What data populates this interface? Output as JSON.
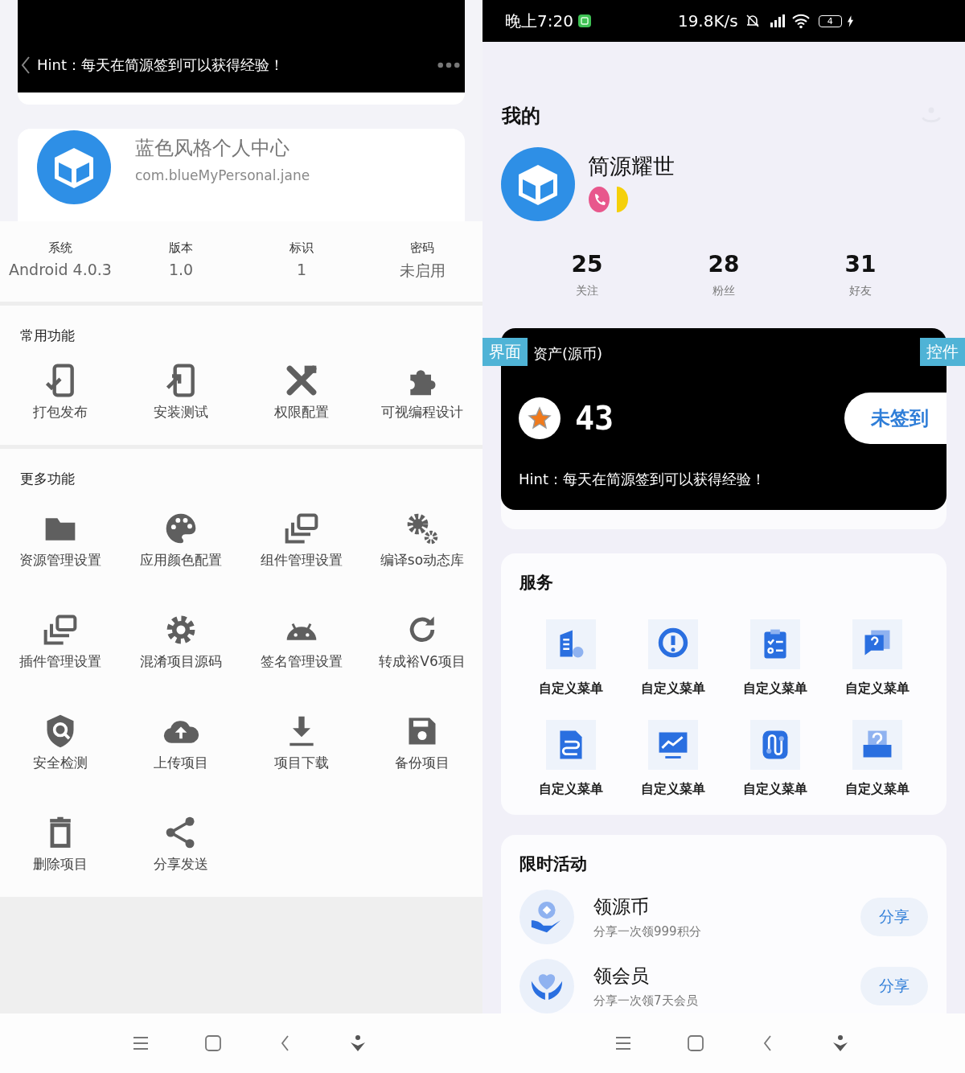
{
  "left_screen": {
    "asset_card": {
      "hint": "Hint：每天在简源签到可以获得经验！"
    },
    "app_card": {
      "title": "蓝色风格个人中心",
      "package": "com.blueMyPersonal.jane"
    },
    "info": [
      {
        "label": "系统",
        "value": "Android 4.0.3"
      },
      {
        "label": "版本",
        "value": "1.0"
      },
      {
        "label": "标识",
        "value": "1"
      },
      {
        "label": "密码",
        "value": "未启用"
      }
    ],
    "sections": [
      {
        "title": "常用功能",
        "items": [
          "打包发布",
          "安装测试",
          "权限配置",
          "可视编程设计"
        ]
      },
      {
        "title": "更多功能",
        "items": [
          "资源管理设置",
          "应用颜色配置",
          "组件管理设置",
          "编译so动态库",
          "插件管理设置",
          "混淆项目源码",
          "签名管理设置",
          "转成裕V6项目",
          "安全检测",
          "上传项目",
          "项目下载",
          "备份项目",
          "删除项目",
          "分享发送"
        ]
      }
    ]
  },
  "right_screen": {
    "status_bar": {
      "time": "晚上7:20",
      "speed": "19.8K/s",
      "battery": "4"
    },
    "title": "我的",
    "profile": {
      "name": "简源耀世"
    },
    "stats": [
      {
        "value": "25",
        "label": "关注"
      },
      {
        "value": "28",
        "label": "粉丝"
      },
      {
        "value": "31",
        "label": "好友"
      }
    ],
    "asset_card": {
      "title": "资产(源币)",
      "coins": "43",
      "button": "未签到",
      "hint": "Hint：每天在简源签到可以获得经验！"
    },
    "services": {
      "title": "服务",
      "items": [
        "自定义菜单",
        "自定义菜单",
        "自定义菜单",
        "自定义菜单",
        "自定义菜单",
        "自定义菜单",
        "自定义菜单",
        "自定义菜单"
      ]
    },
    "activities": {
      "title": "限时活动",
      "items": [
        {
          "title": "领源币",
          "subtitle": "分享一次领999积分",
          "button": "分享"
        },
        {
          "title": "领会员",
          "subtitle": "分享一次领7天会员",
          "button": "分享"
        }
      ]
    }
  },
  "overlay_tags": [
    "界面",
    "控件"
  ]
}
